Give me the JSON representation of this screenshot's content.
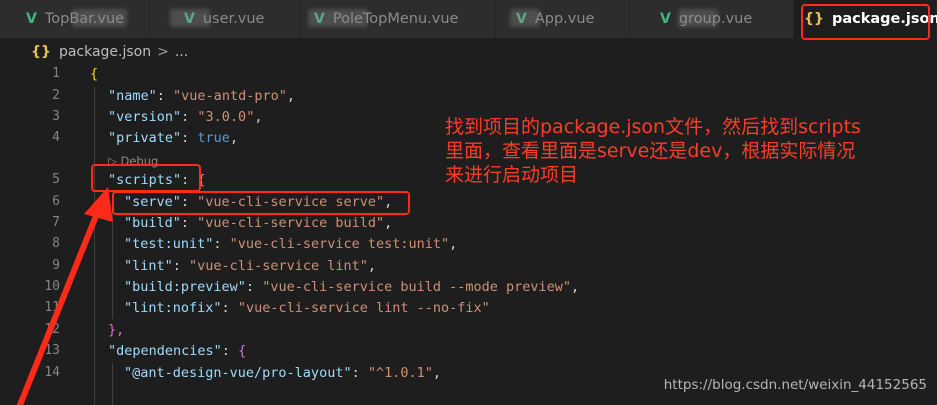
{
  "tabs": [
    {
      "label": "TopBar.vue",
      "icon": "vue-icon",
      "active": false
    },
    {
      "label": "user.vue",
      "icon": "vue-icon",
      "active": false
    },
    {
      "label": "PoleTopMenu.vue",
      "icon": "vue-icon",
      "active": false
    },
    {
      "label": "App.vue",
      "icon": "vue-icon",
      "active": false
    },
    {
      "label": "group.vue",
      "icon": "vue-icon",
      "active": false
    },
    {
      "label": "package.json",
      "icon": "json-icon",
      "active": true
    }
  ],
  "breadcrumb": {
    "file": "package.json",
    "sep": ">",
    "rest": "..."
  },
  "codelens": "▷ Debug",
  "lines": [
    {
      "n": "1"
    },
    {
      "n": "2"
    },
    {
      "n": "3"
    },
    {
      "n": "4"
    },
    {
      "n": "5"
    },
    {
      "n": "6"
    },
    {
      "n": "7"
    },
    {
      "n": "8"
    },
    {
      "n": "9"
    },
    {
      "n": "10"
    },
    {
      "n": "11"
    },
    {
      "n": "12"
    },
    {
      "n": "13"
    },
    {
      "n": "14"
    }
  ],
  "code": {
    "l1": "{",
    "l2k": "\"name\"",
    "l2v": "\"vue-antd-pro\"",
    "l3k": "\"version\"",
    "l3v": "\"3.0.0\"",
    "l4k": "\"private\"",
    "l4v": "true",
    "l5k": "\"scripts\"",
    "l6k": "\"serve\"",
    "l6v": "\"vue-cli-service serve\"",
    "l7k": "\"build\"",
    "l7v": "\"vue-cli-service build\"",
    "l8k": "\"test:unit\"",
    "l8v": "\"vue-cli-service test:unit\"",
    "l9k": "\"lint\"",
    "l9v": "\"vue-cli-service lint\"",
    "l10k": "\"build:preview\"",
    "l10v": "\"vue-cli-service build --mode preview\"",
    "l11k": "\"lint:nofix\"",
    "l11v": "\"vue-cli-service lint --no-fix\"",
    "l12": "},",
    "l13k": "\"dependencies\"",
    "l14k": "\"@ant-design-vue/pro-layout\"",
    "l14v": "\"^1.0.1\""
  },
  "annotation": "找到项目的package.json文件，然后找到scripts\n里面，查看里面是serve还是dev，根据实际情况\n来进行启动项目",
  "watermark": "https://blog.csdn.net/weixin_44152565",
  "colors": {
    "highlight": "#ff2a1a",
    "annotation": "#ff3b2a"
  }
}
